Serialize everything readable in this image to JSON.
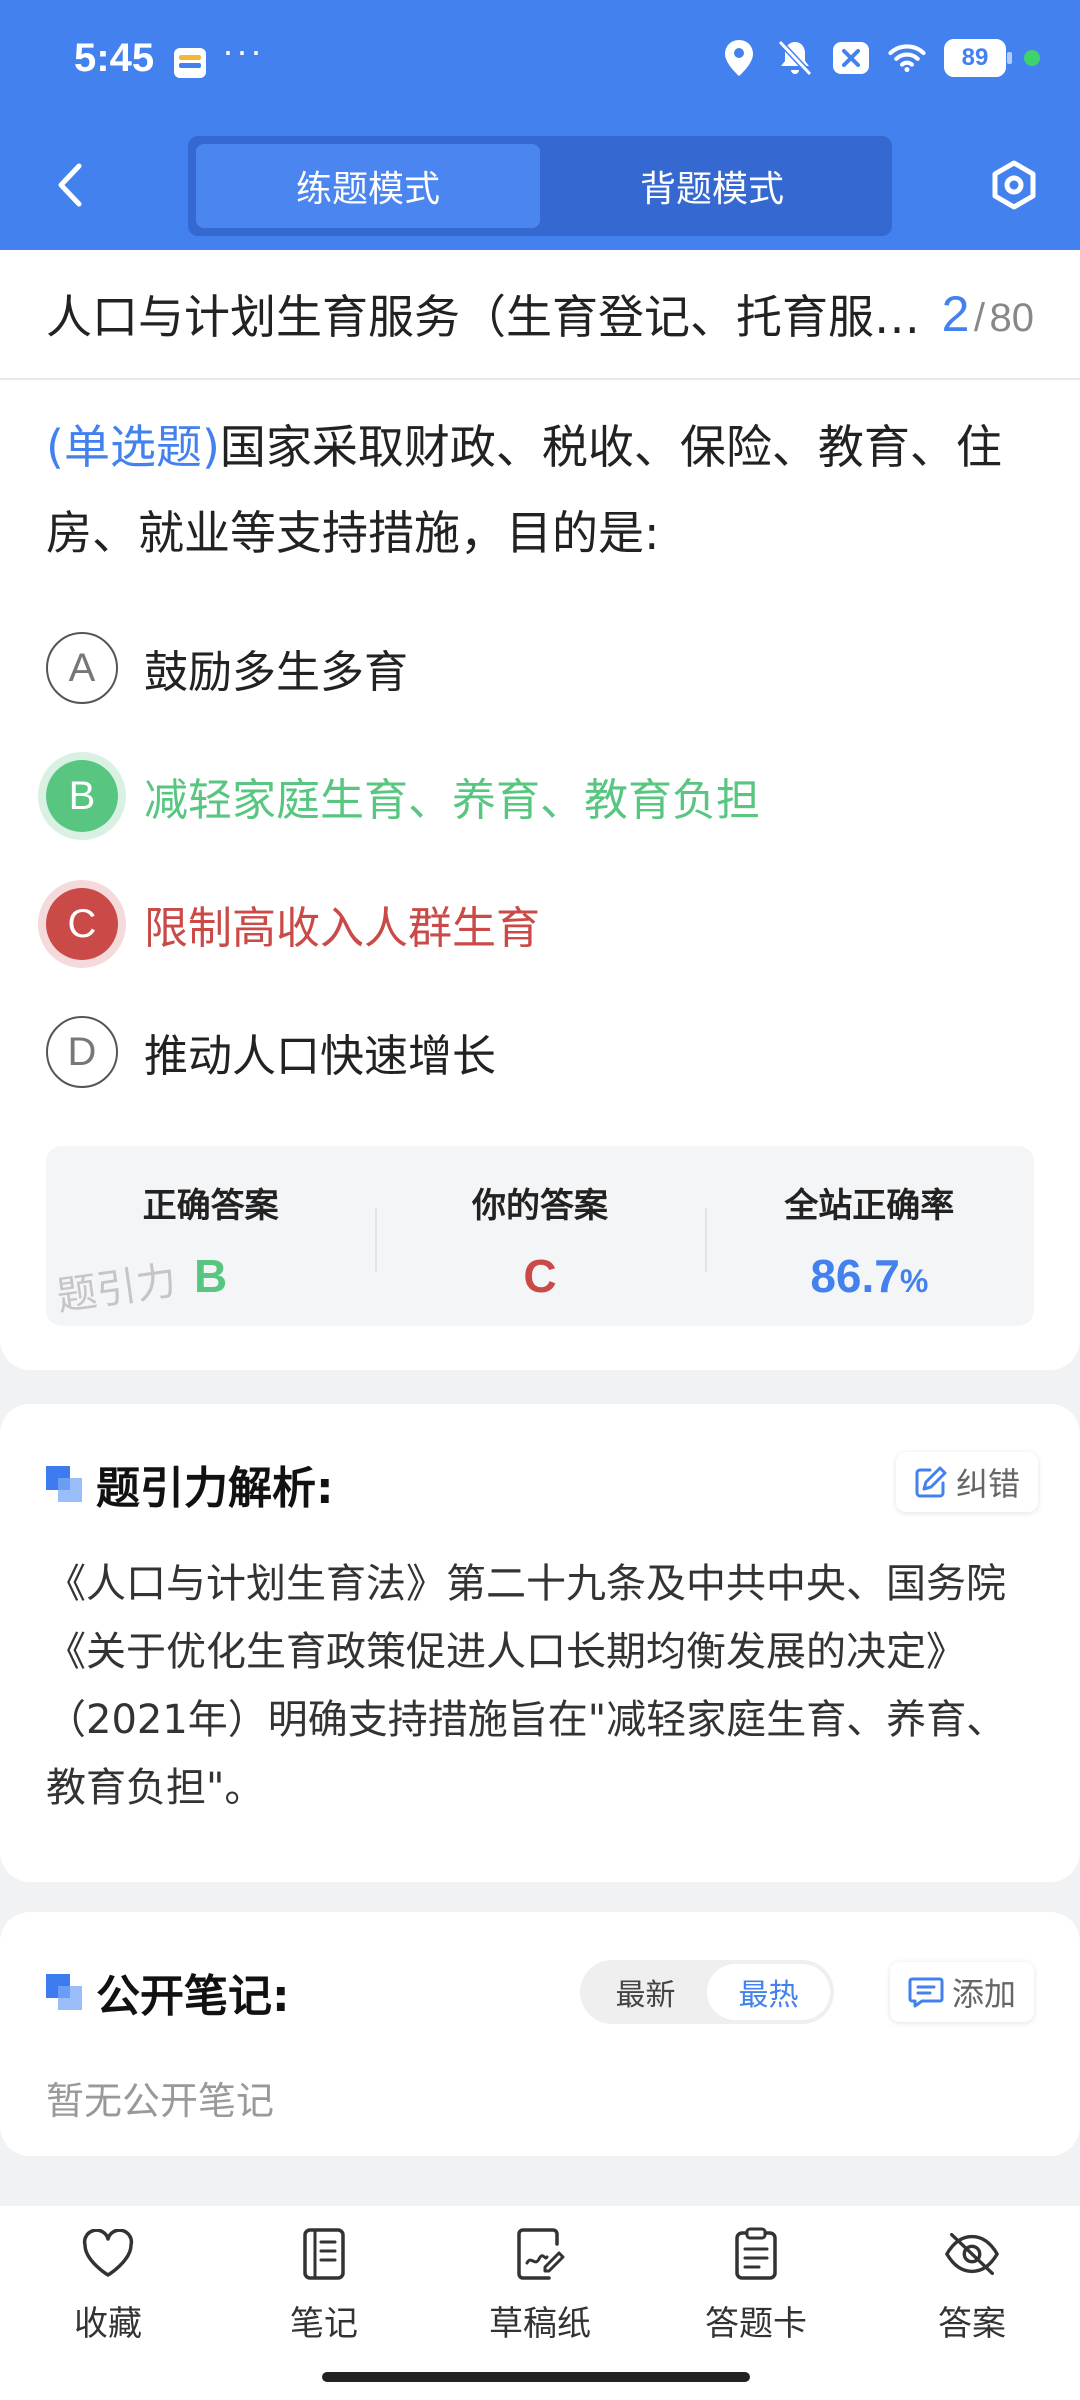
{
  "status_bar": {
    "time": "5:45",
    "dots": "···",
    "battery": "89"
  },
  "nav": {
    "tabs": [
      {
        "label": "练题模式",
        "active": true
      },
      {
        "label": "背题模式",
        "active": false
      }
    ]
  },
  "question": {
    "chapter": "人口与计划生育服务（生育登记、托育服务）",
    "current": "2",
    "separator": "/",
    "total": "80",
    "type_label": "(单选题)",
    "text": "国家采取财政、税收、保险、教育、住房、就业等支持措施，目的是:",
    "options": [
      {
        "letter": "A",
        "text": "鼓励多生多育",
        "state": "normal"
      },
      {
        "letter": "B",
        "text": "减轻家庭生育、养育、教育负担",
        "state": "correct"
      },
      {
        "letter": "C",
        "text": "限制高收入人群生育",
        "state": "wrong"
      },
      {
        "letter": "D",
        "text": "推动人口快速增长",
        "state": "normal"
      }
    ]
  },
  "answer_summary": {
    "correct_label": "正确答案",
    "correct_value": "B",
    "yours_label": "你的答案",
    "yours_value": "C",
    "rate_label": "全站正确率",
    "rate_value": "86.7",
    "rate_unit": "%",
    "watermark": "题引力"
  },
  "analysis": {
    "title": "题引力解析:",
    "report_button": "纠错",
    "text": "《人口与计划生育法》第二十九条及中共中央、国务院《关于优化生育政策促进人口长期均衡发展的决定》（2021年）明确支持措施旨在\"减轻家庭生育、养育、教育负担\"。"
  },
  "notes": {
    "title": "公开笔记:",
    "sort_latest": "最新",
    "sort_hot": "最热",
    "add_button": "添加",
    "empty_text": "暂无公开笔记"
  },
  "bottom_bar": {
    "items": [
      {
        "label": "收藏",
        "icon": "heart-icon"
      },
      {
        "label": "笔记",
        "icon": "notebook-icon"
      },
      {
        "label": "草稿纸",
        "icon": "draft-paper-icon"
      },
      {
        "label": "答题卡",
        "icon": "answer-sheet-icon"
      },
      {
        "label": "答案",
        "icon": "eye-off-icon"
      }
    ]
  },
  "colors": {
    "brand_blue": "#4381ee",
    "correct_green": "#58c681",
    "wrong_red": "#c94a47"
  }
}
